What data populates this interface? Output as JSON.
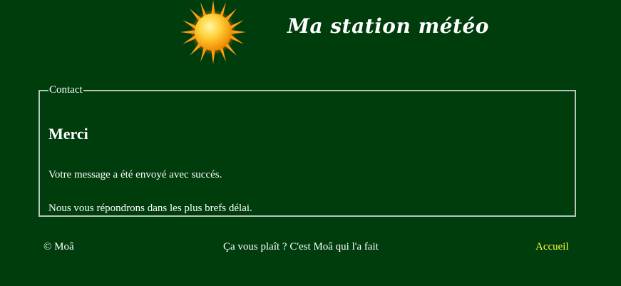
{
  "header": {
    "title": "Ma station météo"
  },
  "contact": {
    "legend": "Contact",
    "heading": "Merci",
    "message_sent": "Votre message a été envoyé avec succés.",
    "reply_notice": "Nous vous répondrons dans les plus brefs délai."
  },
  "footer": {
    "copyright": "© Moâ",
    "tagline": "Ça vous plaît ? C'est Moâ qui l'a fait",
    "home_link": "Accueil"
  },
  "colors": {
    "background": "#003d0c",
    "link": "#ffff3a",
    "border": "#b9c7bc"
  },
  "icons": {
    "logo": "sun-icon"
  }
}
